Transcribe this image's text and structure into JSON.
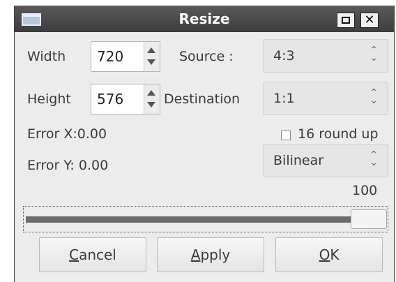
{
  "window": {
    "title": "Resize"
  },
  "titlebar_buttons": {
    "maximize": "maximize-icon",
    "close_glyph": "✕"
  },
  "form": {
    "width_label": "Width",
    "width_value": "720",
    "height_label": "Height",
    "height_value": "576",
    "source_label": "Source :",
    "source_value": "4:3",
    "destination_label": "Destination",
    "destination_value": "1:1",
    "error_x": "Error X:0.00",
    "error_y": "Error Y: 0.00",
    "round_up_label": "16 round up",
    "round_up_checked": false,
    "filter_value": "Bilinear",
    "percent_value": "100",
    "slider_level": 1.0
  },
  "buttons": {
    "cancel_first": "C",
    "cancel_rest": "ancel",
    "apply_first": "A",
    "apply_rest": "pply",
    "ok_first": "O",
    "ok_rest": "K"
  },
  "colors": {
    "titlebar": "#3d3d3d",
    "dialog_bg": "#ececec"
  }
}
